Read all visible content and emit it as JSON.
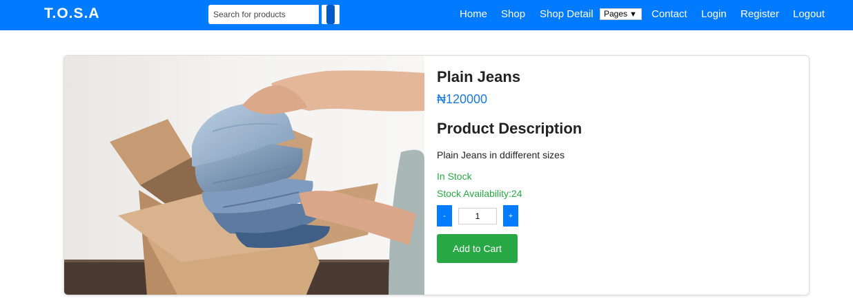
{
  "navbar": {
    "brand": "T.O.S.A",
    "search": {
      "placeholder": "Search for products",
      "value": ""
    },
    "links": {
      "home": "Home",
      "shop": "Shop",
      "shop_detail": "Shop Detail",
      "pages": "Pages",
      "contact": "Contact",
      "login": "Login",
      "register": "Register",
      "logout": "Logout"
    }
  },
  "product": {
    "title": "Plain Jeans",
    "price": "₦120000",
    "description_heading": "Product Description",
    "description": "Plain Jeans in ddifferent sizes",
    "stock_status": "In Stock",
    "stock_availability": "Stock Availability:24",
    "quantity": "1",
    "decrement_label": "-",
    "increment_label": "+",
    "add_to_cart_label": "Add to Cart"
  },
  "colors": {
    "primary": "#007bff",
    "success": "#28a745",
    "price": "#1a7ae0"
  }
}
